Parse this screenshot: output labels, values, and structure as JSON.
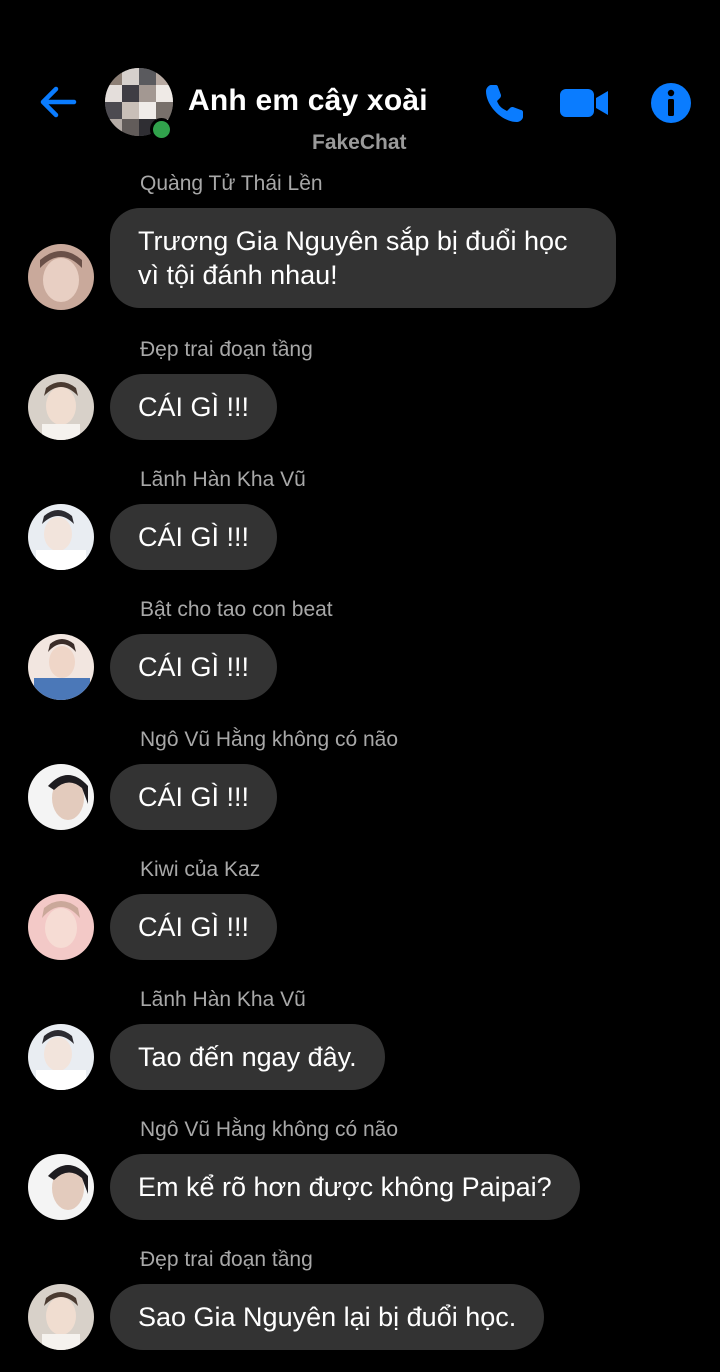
{
  "header": {
    "title": "Anh em cây xoài",
    "watermark": "FakeChat",
    "accent": "#0a7cff",
    "online_color": "#31a24c"
  },
  "messages": [
    {
      "sender": "Quàng Tử Thái Lền",
      "text": "Trương Gia Nguyên sắp bị đuổi học vì tội đánh nhau!"
    },
    {
      "sender": "Đẹp trai đoạn tầng",
      "text": "CÁI GÌ !!!"
    },
    {
      "sender": "Lãnh Hàn Kha Vũ",
      "text": "CÁI GÌ !!!"
    },
    {
      "sender": "Bật cho tao con beat",
      "text": "CÁI GÌ !!!"
    },
    {
      "sender": "Ngô Vũ Hằng không có não",
      "text": "CÁI GÌ !!!"
    },
    {
      "sender": "Kiwi của Kaz",
      "text": "CÁI GÌ !!!"
    },
    {
      "sender": "Lãnh Hàn Kha Vũ",
      "text": "Tao đến ngay đây."
    },
    {
      "sender": "Ngô Vũ Hằng không có não",
      "text": "Em kể rõ hơn được không Paipai?"
    },
    {
      "sender": "Đẹp trai đoạn tầng",
      "text": "Sao Gia Nguyên lại bị đuổi học."
    }
  ],
  "icons": {
    "back": "arrow-left-icon",
    "call": "phone-icon",
    "video": "video-camera-icon",
    "info": "info-icon"
  },
  "colors": {
    "background": "#000000",
    "bubble": "#333333",
    "sender_name": "#a8a8a8"
  }
}
